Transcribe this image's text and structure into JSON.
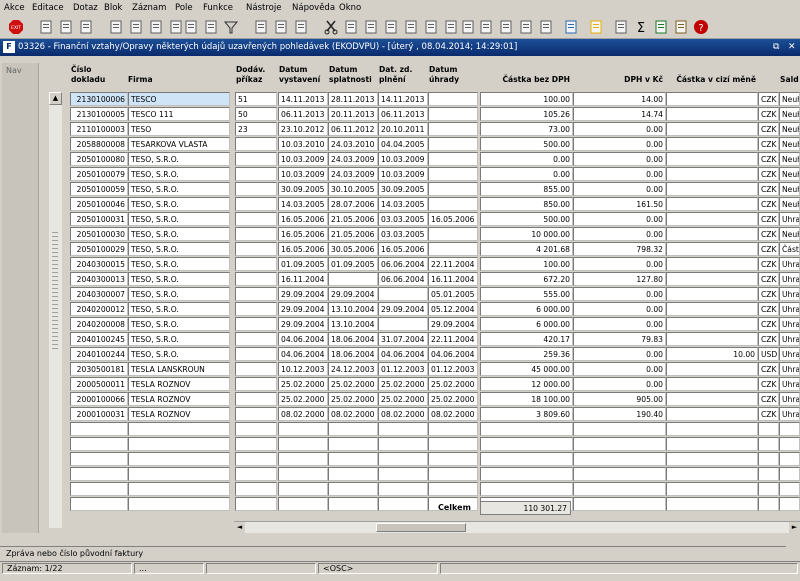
{
  "menu": [
    "Akce",
    "Editace",
    "Dotaz",
    "Blok",
    "Záznam",
    "Pole",
    "Funkce",
    "Nástroje",
    "Nápověda",
    "Okno"
  ],
  "toolbar_icons": [
    "exit-icon",
    "save-icon",
    "print-setup-icon",
    "print-icon",
    "clear-icon",
    "enter-query-icon",
    "execute-query-icon",
    "cancel-query-icon",
    "sort-asc-icon",
    "sort-desc-icon",
    "filter-icon",
    "printer-icon",
    "attach-icon",
    "mail-icon",
    "cut-icon",
    "copy-icon",
    "paste-icon",
    "find-icon",
    "list-icon",
    "edit-icon",
    "calc-icon",
    "record-icon",
    "note-icon",
    "document-icon",
    "form-icon",
    "gears-icon",
    "globe-icon",
    "warning-icon",
    "email-icon",
    "sum-icon",
    "excel-icon",
    "key-icon",
    "help-icon"
  ],
  "window": {
    "app_icon": "F",
    "title": "03326 - Finanční vztahy/Opravy některých údajů uzavřených pohledávek (EKODVPU) - [úterý  , 08.04.2014; 14:29:01]",
    "restore": "⧉",
    "close": "✕"
  },
  "nav": {
    "label": "Nav"
  },
  "columns": {
    "cislo": "Číslo\ndokladu",
    "firma": "Firma",
    "dodav": "Dodáv.\npříkaz",
    "vystaveni": "Datum\nvystavení",
    "splatnosti": "Datum\nsplatnosti",
    "plneni": "Dat. zd.\nplnění",
    "uhrady": "Datum\núhrady",
    "castka": "Částka bez DPH",
    "dph": "DPH v Kč",
    "cizi": "Částka v cizí měně",
    "saldo": "Sald"
  },
  "rows": [
    {
      "cislo": "2130100006",
      "firma": "TESCO",
      "dodav": "51",
      "vyst": "14.11.2013",
      "splat": "28.11.2013",
      "plneni": "14.11.2013",
      "uhrady": "",
      "castka": "100.00",
      "dph": "14.00",
      "cizi": "",
      "mena": "CZK",
      "saldo": "Neuh"
    },
    {
      "cislo": "2130100005",
      "firma": "TESCO 111",
      "dodav": "50",
      "vyst": "06.11.2013",
      "splat": "20.11.2013",
      "plneni": "06.11.2013",
      "uhrady": "",
      "castka": "105.26",
      "dph": "14.74",
      "cizi": "",
      "mena": "CZK",
      "saldo": "Neuh"
    },
    {
      "cislo": "2110100003",
      "firma": "TESO",
      "dodav": "23",
      "vyst": "23.10.2012",
      "splat": "06.11.2012",
      "plneni": "20.10.2011",
      "uhrady": "",
      "castka": "73.00",
      "dph": "0.00",
      "cizi": "",
      "mena": "CZK",
      "saldo": "Neuh"
    },
    {
      "cislo": "2058800008",
      "firma": "TESARKOVA VLASTA",
      "dodav": "",
      "vyst": "10.03.2010",
      "splat": "24.03.2010",
      "plneni": "04.04.2005",
      "uhrady": "",
      "castka": "500.00",
      "dph": "0.00",
      "cizi": "",
      "mena": "CZK",
      "saldo": "Neuh"
    },
    {
      "cislo": "2050100080",
      "firma": "TESO, S.R.O.",
      "dodav": "",
      "vyst": "10.03.2009",
      "splat": "24.03.2009",
      "plneni": "10.03.2009",
      "uhrady": "",
      "castka": "0.00",
      "dph": "0.00",
      "cizi": "",
      "mena": "CZK",
      "saldo": "Neuh"
    },
    {
      "cislo": "2050100079",
      "firma": "TESO, S.R.O.",
      "dodav": "",
      "vyst": "10.03.2009",
      "splat": "24.03.2009",
      "plneni": "10.03.2009",
      "uhrady": "",
      "castka": "0.00",
      "dph": "0.00",
      "cizi": "",
      "mena": "CZK",
      "saldo": "Neuh"
    },
    {
      "cislo": "2050100059",
      "firma": "TESO, S.R.O.",
      "dodav": "",
      "vyst": "30.09.2005",
      "splat": "30.10.2005",
      "plneni": "30.09.2005",
      "uhrady": "",
      "castka": "855.00",
      "dph": "0.00",
      "cizi": "",
      "mena": "CZK",
      "saldo": "Neuh"
    },
    {
      "cislo": "2050100046",
      "firma": "TESO, S.R.O.",
      "dodav": "",
      "vyst": "14.03.2005",
      "splat": "28.07.2006",
      "plneni": "14.03.2005",
      "uhrady": "",
      "castka": "850.00",
      "dph": "161.50",
      "cizi": "",
      "mena": "CZK",
      "saldo": "Neuh"
    },
    {
      "cislo": "2050100031",
      "firma": "TESO, S.R.O.",
      "dodav": "",
      "vyst": "16.05.2006",
      "splat": "21.05.2006",
      "plneni": "03.03.2005",
      "uhrady": "16.05.2006",
      "castka": "500.00",
      "dph": "0.00",
      "cizi": "",
      "mena": "CZK",
      "saldo": "Uhra"
    },
    {
      "cislo": "2050100030",
      "firma": "TESO, S.R.O.",
      "dodav": "",
      "vyst": "16.05.2006",
      "splat": "21.05.2006",
      "plneni": "03.03.2005",
      "uhrady": "",
      "castka": "10 000.00",
      "dph": "0.00",
      "cizi": "",
      "mena": "CZK",
      "saldo": "Neuh"
    },
    {
      "cislo": "2050100029",
      "firma": "TESO, S.R.O.",
      "dodav": "",
      "vyst": "16.05.2006",
      "splat": "30.05.2006",
      "plneni": "16.05.2006",
      "uhrady": "",
      "castka": "4 201.68",
      "dph": "798.32",
      "cizi": "",
      "mena": "CZK",
      "saldo": "Část"
    },
    {
      "cislo": "2040300015",
      "firma": "TESO, S.R.O.",
      "dodav": "",
      "vyst": "01.09.2005",
      "splat": "01.09.2005",
      "plneni": "06.06.2004",
      "uhrady": "22.11.2004",
      "castka": "100.00",
      "dph": "0.00",
      "cizi": "",
      "mena": "CZK",
      "saldo": "Uhra"
    },
    {
      "cislo": "2040300013",
      "firma": "TESO, S.R.O.",
      "dodav": "",
      "vyst": "16.11.2004",
      "splat": "",
      "plneni": "06.06.2004",
      "uhrady": "16.11.2004",
      "castka": "672.20",
      "dph": "127.80",
      "cizi": "",
      "mena": "CZK",
      "saldo": "Uhra"
    },
    {
      "cislo": "2040300007",
      "firma": "TESO, S.R.O.",
      "dodav": "",
      "vyst": "29.09.2004",
      "splat": "29.09.2004",
      "plneni": "",
      "uhrady": "05.01.2005",
      "castka": "555.00",
      "dph": "0.00",
      "cizi": "",
      "mena": "CZK",
      "saldo": "Uhra"
    },
    {
      "cislo": "2040200012",
      "firma": "TESO, S.R.O.",
      "dodav": "",
      "vyst": "29.09.2004",
      "splat": "13.10.2004",
      "plneni": "29.09.2004",
      "uhrady": "05.12.2004",
      "castka": "6 000.00",
      "dph": "0.00",
      "cizi": "",
      "mena": "CZK",
      "saldo": "Uhra"
    },
    {
      "cislo": "2040200008",
      "firma": "TESO, S.R.O.",
      "dodav": "",
      "vyst": "29.09.2004",
      "splat": "13.10.2004",
      "plneni": "",
      "uhrady": "29.09.2004",
      "castka": "6 000.00",
      "dph": "0.00",
      "cizi": "",
      "mena": "CZK",
      "saldo": "Uhra"
    },
    {
      "cislo": "2040100245",
      "firma": "TESO, S.R.O.",
      "dodav": "",
      "vyst": "04.06.2004",
      "splat": "18.06.2004",
      "plneni": "31.07.2004",
      "uhrady": "22.11.2004",
      "castka": "420.17",
      "dph": "79.83",
      "cizi": "",
      "mena": "CZK",
      "saldo": "Uhra"
    },
    {
      "cislo": "2040100244",
      "firma": "TESO, S.R.O.",
      "dodav": "",
      "vyst": "04.06.2004",
      "splat": "18.06.2004",
      "plneni": "04.06.2004",
      "uhrady": "04.06.2004",
      "castka": "259.36",
      "dph": "0.00",
      "cizi": "10.00",
      "mena": "USD",
      "saldo": "Uhra"
    },
    {
      "cislo": "2030500181",
      "firma": "TESLA LANSKROUN",
      "dodav": "",
      "vyst": "10.12.2003",
      "splat": "24.12.2003",
      "plneni": "01.12.2003",
      "uhrady": "01.12.2003",
      "castka": "45 000.00",
      "dph": "0.00",
      "cizi": "",
      "mena": "CZK",
      "saldo": "Uhra"
    },
    {
      "cislo": "2000500011",
      "firma": "TESLA ROZNOV",
      "dodav": "",
      "vyst": "25.02.2000",
      "splat": "25.02.2000",
      "plneni": "25.02.2000",
      "uhrady": "25.02.2000",
      "castka": "12 000.00",
      "dph": "0.00",
      "cizi": "",
      "mena": "CZK",
      "saldo": "Uhra"
    },
    {
      "cislo": "2000100066",
      "firma": "TESLA ROZNOV",
      "dodav": "",
      "vyst": "25.02.2000",
      "splat": "25.02.2000",
      "plneni": "25.02.2000",
      "uhrady": "25.02.2000",
      "castka": "18 100.00",
      "dph": "905.00",
      "cizi": "",
      "mena": "CZK",
      "saldo": "Uhra"
    },
    {
      "cislo": "2000100031",
      "firma": "TESLA ROZNOV",
      "dodav": "",
      "vyst": "08.02.2000",
      "splat": "08.02.2000",
      "plneni": "08.02.2000",
      "uhrady": "08.02.2000",
      "castka": "3 809.60",
      "dph": "190.40",
      "cizi": "",
      "mena": "CZK",
      "saldo": "Uhra"
    }
  ],
  "empty_rows": 6,
  "total": {
    "label": "Celkem",
    "value": "110 301.27"
  },
  "status": {
    "message": "Zpráva nebo číslo původní faktury",
    "record": "Záznam: 1/22",
    "seg2": "...",
    "seg3": "",
    "seg4": "<OSC>",
    "seg5": ""
  },
  "colors": {
    "title_bar": "#0a2a6c",
    "selected_cell": "#cfe4f7",
    "chrome": "#d4d0c8"
  }
}
